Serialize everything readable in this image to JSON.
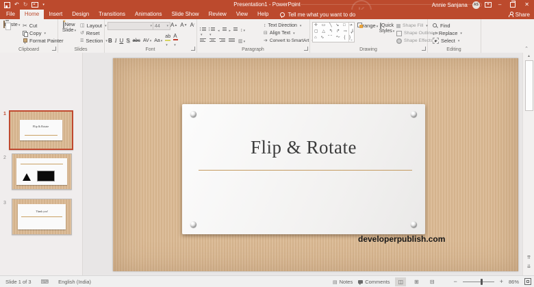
{
  "titlebar": {
    "title": "Presentation1 - PowerPoint",
    "user": {
      "name": "Annie Sanjana",
      "initials": "AS"
    }
  },
  "tabs": {
    "file": "File",
    "home": "Home",
    "insert": "Insert",
    "design": "Design",
    "transitions": "Transitions",
    "animations": "Animations",
    "slide_show": "Slide Show",
    "review": "Review",
    "view": "View",
    "help": "Help"
  },
  "tell_me": "Tell me what you want to do",
  "share_label": "Share",
  "ribbon": {
    "clipboard": {
      "label": "Clipboard",
      "paste": "Paste",
      "cut": "Cut",
      "copy": "Copy",
      "format_painter": "Format Painter"
    },
    "slides": {
      "label": "Slides",
      "new_slide_1": "New",
      "new_slide_2": "Slide",
      "layout": "Layout",
      "reset": "Reset",
      "section": "Section"
    },
    "font": {
      "label": "Font",
      "size_value": "44",
      "bold": "B",
      "italic": "I",
      "underline": "U",
      "shadow": "S",
      "strike": "abc",
      "spacing": "AV",
      "case": "Aa",
      "highlight": "ab",
      "color": "A",
      "grow": "A",
      "shrink": "A",
      "clear": "A"
    },
    "paragraph": {
      "label": "Paragraph",
      "text_direction": "Text Direction",
      "align_text": "Align Text",
      "convert": "Convert to SmartArt"
    },
    "drawing": {
      "label": "Drawing",
      "arrange": "Arrange",
      "quick_1": "Quick",
      "quick_2": "Styles",
      "shape_fill": "Shape Fill",
      "shape_outline": "Shape Outline",
      "shape_effects": "Shape Effects"
    },
    "editing": {
      "label": "Editing",
      "find": "Find",
      "replace": "Replace",
      "select": "Select"
    }
  },
  "thumbnails": [
    {
      "number": "1",
      "title": "Flip & Rotate"
    },
    {
      "number": "2",
      "title": ""
    },
    {
      "number": "3",
      "title": "Thank you!"
    }
  ],
  "slide": {
    "title": "Flip & Rotate",
    "watermark": "developerpublish.com"
  },
  "statusbar": {
    "slide_indicator": "Slide 1 of 3",
    "language": "English (India)",
    "notes": "Notes",
    "comments": "Comments",
    "zoom_value": "86%"
  },
  "colors": {
    "brand_red": "#BC4A2D",
    "selection_red": "#C0492F",
    "accent_tan": "#C49A5F",
    "slide_stripe_light": "#DDBE9B",
    "slide_stripe_dark": "#D4B38D"
  }
}
